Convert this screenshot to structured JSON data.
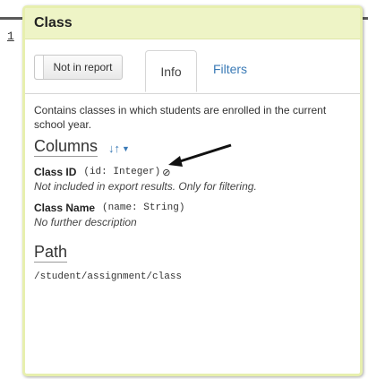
{
  "editor": {
    "line_number": "1"
  },
  "popover": {
    "title": "Class",
    "toggle_label": "Not in report",
    "tabs": [
      {
        "label": "Info",
        "active": true
      },
      {
        "label": "Filters",
        "active": false
      }
    ],
    "description": "Contains classes in which students are enrolled in the current school year.",
    "columns_heading": "Columns",
    "sort_icon": "sort-icon",
    "columns": [
      {
        "name": "Class ID",
        "type": "(id: Integer)",
        "icon": "not-exported-icon",
        "note": "Not included in export results. Only for filtering."
      },
      {
        "name": "Class Name",
        "type": "(name: String)",
        "note": "No further description"
      }
    ],
    "path_heading": "Path",
    "path": "/student/assignment/class"
  },
  "colors": {
    "header_bg": "#eef4c6",
    "border": "#e7efae",
    "link": "#3a7ab6"
  }
}
